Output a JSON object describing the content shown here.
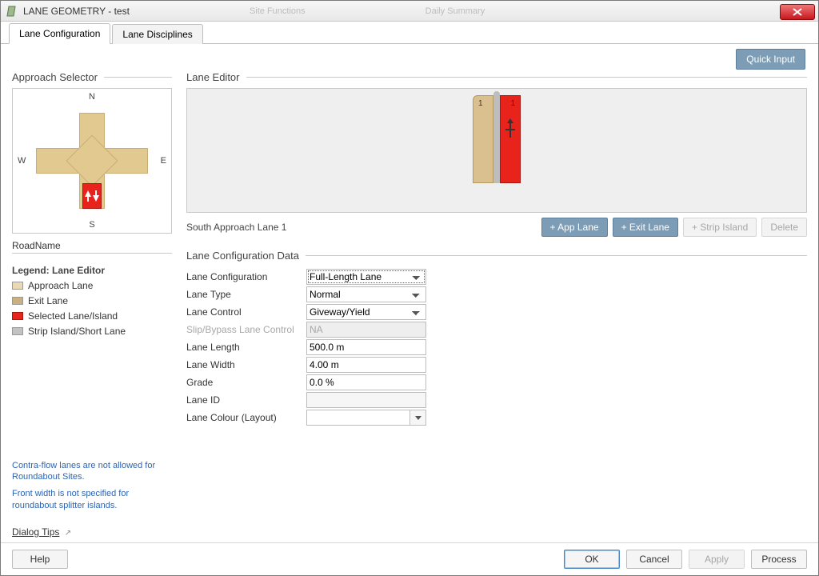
{
  "window": {
    "title": "LANE GEOMETRY - test",
    "bg_hints": [
      "Site Functions",
      "Daily Summary"
    ]
  },
  "tabs": [
    {
      "label": "Lane Configuration",
      "active": true
    },
    {
      "label": "Lane Disciplines",
      "active": false
    }
  ],
  "quick_input_label": "Quick Input",
  "left": {
    "approach_selector_title": "Approach Selector",
    "compass": {
      "n": "N",
      "s": "S",
      "e": "E",
      "w": "W"
    },
    "roadname_label": "RoadName",
    "legend_title": "Legend: Lane Editor",
    "legend": [
      {
        "label": "Approach Lane",
        "swatch": "sw-approach"
      },
      {
        "label": "Exit Lane",
        "swatch": "sw-exit"
      },
      {
        "label": "Selected Lane/Island",
        "swatch": "sw-selected"
      },
      {
        "label": "Strip Island/Short Lane",
        "swatch": "sw-strip"
      }
    ],
    "messages": [
      "Contra-flow lanes are not allowed for Roundabout Sites.",
      "Front width is not specified for roundabout splitter islands."
    ],
    "dialog_tips_label": "Dialog Tips"
  },
  "editor": {
    "title": "Lane Editor",
    "caption": "South Approach Lane 1",
    "lane_numbers": {
      "approach": "1",
      "exit": "1"
    },
    "buttons": {
      "add_app": "+ App Lane",
      "add_exit": "+ Exit Lane",
      "add_strip": "+ Strip Island",
      "delete": "Delete"
    }
  },
  "config": {
    "title": "Lane Configuration Data",
    "rows": {
      "lane_configuration": {
        "label": "Lane Configuration",
        "value": "Full-Length Lane"
      },
      "lane_type": {
        "label": "Lane Type",
        "value": "Normal"
      },
      "lane_control": {
        "label": "Lane Control",
        "value": "Giveway/Yield"
      },
      "slip": {
        "label": "Slip/Bypass Lane Control",
        "value": "NA"
      },
      "lane_length": {
        "label": "Lane Length",
        "value": "500.0 m"
      },
      "lane_width": {
        "label": "Lane Width",
        "value": "4.00 m"
      },
      "grade": {
        "label": "Grade",
        "value": "0.0 %"
      },
      "lane_id": {
        "label": "Lane ID",
        "value": ""
      },
      "lane_colour": {
        "label": "Lane Colour (Layout)"
      }
    }
  },
  "footer": {
    "help": "Help",
    "ok": "OK",
    "cancel": "Cancel",
    "apply": "Apply",
    "process": "Process"
  }
}
